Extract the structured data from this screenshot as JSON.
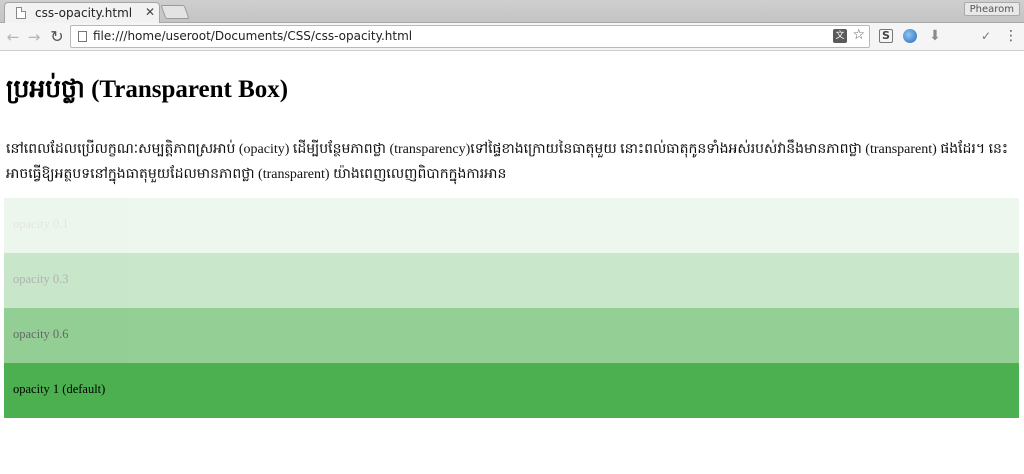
{
  "browser": {
    "tab_title": "css-opacity.html",
    "tab_close": "✕",
    "profile_name": "Phearom",
    "url": "file:///home/useroot/Documents/CSS/css-opacity.html",
    "icons": {
      "back": "←",
      "forward": "→",
      "reload": "↻",
      "star": "☆",
      "translate": "文",
      "ext_s": "S",
      "download": "⬇",
      "check": "✓",
      "menu": "⋮"
    }
  },
  "page": {
    "heading": "ប្រអប់ថ្លា (Transparent Box)",
    "intro": "នៅពេលដែលប្រើលក្ខណៈសម្បត្តិភាពស្រអាប់ (opacity) ដើម្បីបន្ថែមភាពថ្លា (transparency)ទៅផ្ទៃខាងក្រោយនៃធាតុមួយ នោះពល់ធាតុកូនទាំងអស់របស់វានឹងមានភាពថ្លា (transparent) ផងដែរ។ នេះអាចធ្វើឱ្យអត្ថបទនៅក្នុងធាតុមួយដែលមានភាពថ្លា (transparent) យ៉ាងពេញលេញពិបាកក្នុងការអាន",
    "boxes": [
      {
        "label": "opacity 0.1",
        "opacity": 0.1
      },
      {
        "label": "opacity 0.3",
        "opacity": 0.3
      },
      {
        "label": "opacity 0.6",
        "opacity": 0.6
      },
      {
        "label": "opacity 1 (default)",
        "opacity": 1
      }
    ],
    "box_color": "#4CAF50"
  }
}
